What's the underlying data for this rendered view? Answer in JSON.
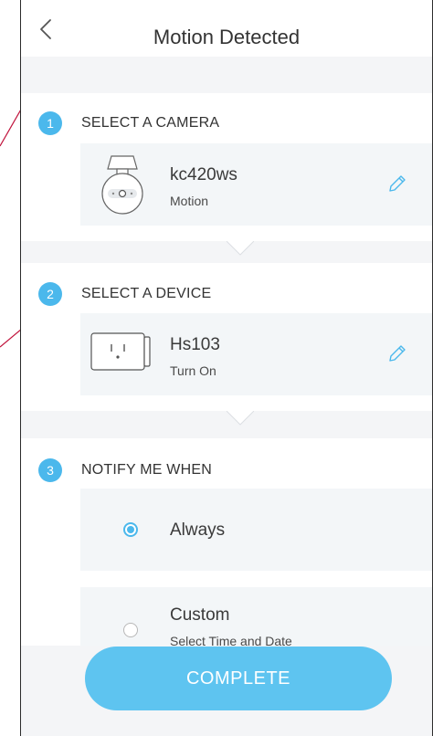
{
  "header": {
    "title": "Motion Detected",
    "back_icon": "chevron-left-icon"
  },
  "step1": {
    "number": "1",
    "title": "SELECT A CAMERA",
    "device_name": "kc420ws",
    "device_sub": "Motion",
    "device_icon": "camera-icon",
    "edit_icon": "pencil-icon"
  },
  "step2": {
    "number": "2",
    "title": "SELECT A DEVICE",
    "device_name": "Hs103",
    "device_sub": "Turn On",
    "device_icon": "smart-plug-icon",
    "edit_icon": "pencil-icon"
  },
  "step3": {
    "number": "3",
    "title": "NOTIFY ME WHEN",
    "options": [
      {
        "label": "Always",
        "sublabel": "",
        "selected": true
      },
      {
        "label": "Custom",
        "sublabel": "Select Time and Date",
        "selected": false
      }
    ]
  },
  "footer": {
    "complete_label": "COMPLETE"
  },
  "colors": {
    "accent": "#4bb8ec",
    "button": "#5ec4f0",
    "card_bg": "#f3f6f8",
    "gap_bg": "#f4f5f7",
    "external_line": "#c0133c"
  }
}
